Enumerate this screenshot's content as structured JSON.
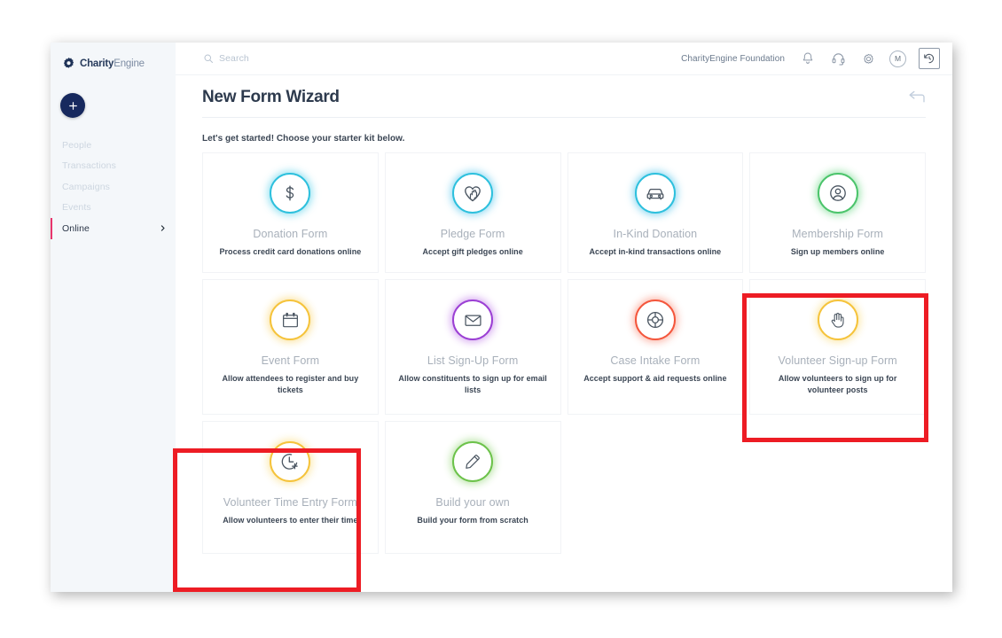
{
  "brand": {
    "name_bold": "Charity",
    "name_light": "Engine",
    "logo_icon": "gear-flower-icon"
  },
  "sidebar": {
    "add_button_icon": "plus-icon",
    "items": [
      {
        "label": "People",
        "active": false
      },
      {
        "label": "Transactions",
        "active": false
      },
      {
        "label": "Campaigns",
        "active": false
      },
      {
        "label": "Events",
        "active": false
      },
      {
        "label": "Online",
        "active": true,
        "chevron_icon": "chevron-right-icon"
      }
    ]
  },
  "topbar": {
    "search_icon": "search-icon",
    "search_placeholder": "Search",
    "search_value": "",
    "org_name": "CharityEngine Foundation",
    "notifications_icon": "bell-icon",
    "support_icon": "headset-icon",
    "settings_icon": "gear-icon",
    "avatar_initial": "M",
    "history_icon": "history-clock-back-icon"
  },
  "page": {
    "title": "New Form Wizard",
    "back_icon": "back-arrow-icon",
    "subtitle": "Let's get started! Choose your starter kit below."
  },
  "cards": [
    {
      "title": "Donation Form",
      "desc": "Process credit card donations online",
      "icon": "dollar-sign-icon",
      "color": "#2dc0dd",
      "glow": "#7fdcee",
      "highlighted": false
    },
    {
      "title": "Pledge Form",
      "desc": "Accept gift pledges online",
      "icon": "heart-hand-icon",
      "color": "#2dc0dd",
      "glow": "#86d6f2",
      "highlighted": false
    },
    {
      "title": "In-Kind Donation",
      "desc": "Accept in-kind transactions online",
      "icon": "car-icon",
      "color": "#2dc0dd",
      "glow": "#7fd4f0",
      "highlighted": false
    },
    {
      "title": "Membership Form",
      "desc": "Sign up members online",
      "icon": "person-circle-icon",
      "color": "#4bc46b",
      "glow": "#96e3a8",
      "highlighted": false
    },
    {
      "title": "Event Form",
      "desc": "Allow attendees to register and buy tickets",
      "icon": "calendar-icon",
      "color": "#f5c33b",
      "glow": "#fbe29a",
      "highlighted": false
    },
    {
      "title": "List Sign-Up Form",
      "desc": "Allow constituents to sign up for email lists",
      "icon": "envelope-icon",
      "color": "#9b3fd4",
      "glow": "#d3a3ef",
      "highlighted": false
    },
    {
      "title": "Case Intake Form",
      "desc": "Accept support & aid requests online",
      "icon": "lifebuoy-icon",
      "color": "#f4563c",
      "glow": "#fbb0a1",
      "highlighted": false
    },
    {
      "title": "Volunteer Sign-up Form",
      "desc": "Allow volunteers to sign up for volunteer posts",
      "icon": "raised-hand-icon",
      "color": "#f5c33b",
      "glow": "#fbe7a7",
      "highlighted": true
    },
    {
      "title": "Volunteer Time Entry Form",
      "desc": "Allow volunteers to enter their time",
      "icon": "clock-plus-icon",
      "color": "#f5c33b",
      "glow": "#fbe7a7",
      "highlighted": true
    },
    {
      "title": "Build your own",
      "desc": "Build your form from scratch",
      "icon": "pencil-icon",
      "color": "#6cc24a",
      "glow": "#b5e3a1",
      "highlighted": false
    }
  ],
  "annotations": {
    "color": "#ed1c24",
    "boxes": [
      {
        "target": "Volunteer Sign-up Form"
      },
      {
        "target": "Volunteer Time Entry Form"
      }
    ]
  }
}
